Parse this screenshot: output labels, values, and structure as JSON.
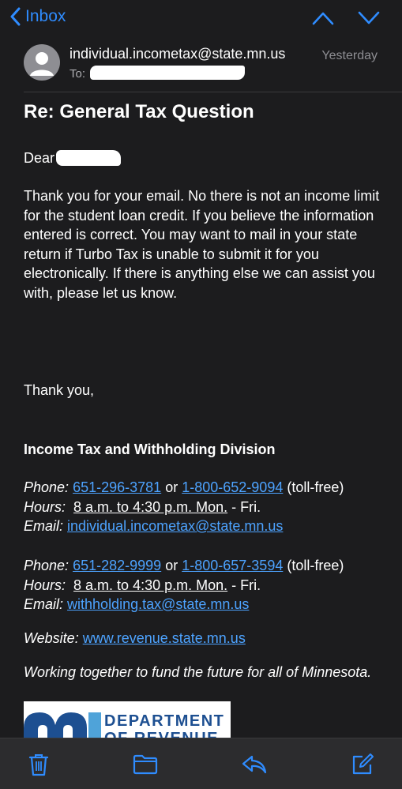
{
  "nav": {
    "back_label": "Inbox",
    "icons": [
      "chevron-left-icon",
      "chevron-up-icon",
      "chevron-down-icon"
    ]
  },
  "email": {
    "from": "individual.incometax@state.mn.us",
    "date": "Yesterday",
    "to_label": "To:",
    "subject": "Re: General Tax Question",
    "greeting": "Dear",
    "body": "Thank you for your email. No there is not an income limit for the student loan credit. If you believe the information entered is correct. You may want to mail in your state return if Turbo Tax is unable to submit it for you electronically. If there is anything else we can assist you with, please let us know.",
    "closing": "Thank you,",
    "division": "Income Tax and Withholding Division",
    "contacts": [
      {
        "phone_label": "Phone:",
        "phone": "651-296-3781",
        "or": "or",
        "tollfree_phone": "1-800-652-9094",
        "tollfree_label": "(toll-free)",
        "hours_label": "Hours:",
        "hours": "8 a.m. to 4:30 p.m. Mon.",
        "hours_days": "- Fri.",
        "email_label": "Email:",
        "email": "individual.incometax@state.mn.us"
      },
      {
        "phone_label": "Phone:",
        "phone": "651-282-9999",
        "or": "or",
        "tollfree_phone": "1-800-657-3594",
        "tollfree_label": "(toll-free)",
        "hours_label": "Hours:",
        "hours": "8 a.m. to 4:30 p.m. Mon.",
        "hours_days": "- Fri.",
        "email_label": "Email:",
        "email": "withholding.tax@state.mn.us"
      }
    ],
    "website_label": "Website:",
    "website": "www.revenue.state.mn.us",
    "motto": "Working together to fund the future for all of Minnesota.",
    "logo": {
      "line1": "DEPARTMENT",
      "line2": "OF REVENUE"
    }
  },
  "toolbar": {
    "icons": [
      "trash-icon",
      "folder-icon",
      "reply-icon",
      "compose-icon"
    ]
  },
  "colors": {
    "background": "#1c1c1e",
    "accent": "#2f8cff",
    "link": "#4da3ff",
    "secondary_text": "#8e8e93",
    "logo_blue": "#1d4f91"
  }
}
